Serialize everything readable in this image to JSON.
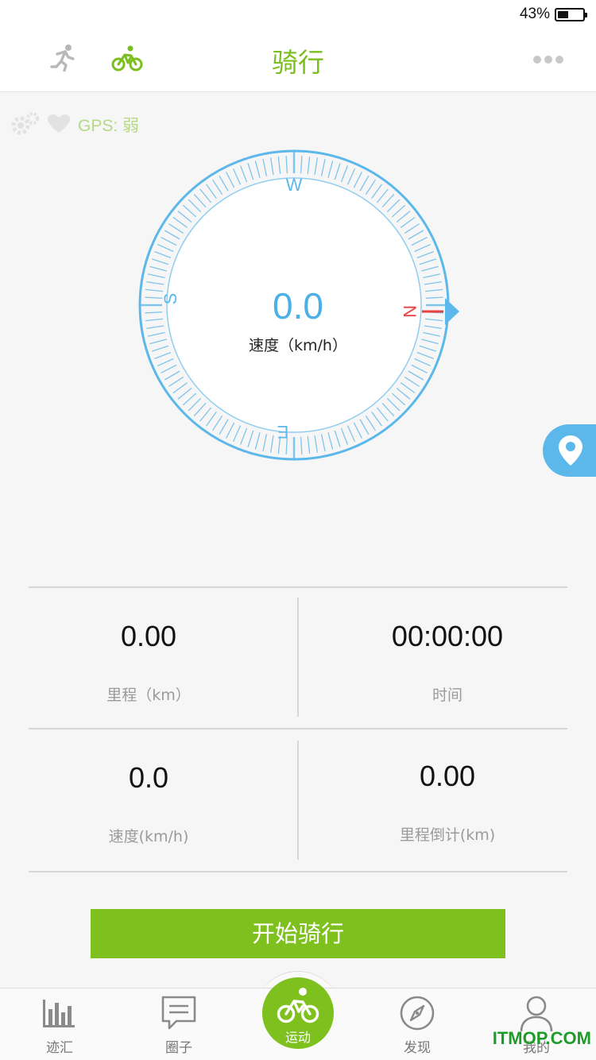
{
  "status_bar": {
    "battery_text": "43%",
    "battery_level": 0.43
  },
  "nav": {
    "title": "骑行",
    "tabs": [
      {
        "icon": "running-icon",
        "active": false
      },
      {
        "icon": "bicycle-icon",
        "active": true
      }
    ],
    "more_icon": "more-icon"
  },
  "gps": {
    "text": "GPS: 弱",
    "icons": [
      "gear-icon",
      "heart-icon"
    ]
  },
  "compass": {
    "directions": {
      "top": "W",
      "right": "N",
      "bottom": "E",
      "left": "S"
    },
    "speed_value": "0.0",
    "speed_label": "速度（km/h）"
  },
  "location_button": {
    "icon": "location-pin-icon"
  },
  "stats": [
    {
      "value": "0.00",
      "label": "里程（km）"
    },
    {
      "value": "00:00:00",
      "label": "时间"
    },
    {
      "value": "0.0",
      "label": "速度(km/h)"
    },
    {
      "value": "0.00",
      "label": "里程倒计(km)"
    }
  ],
  "start_button": {
    "label": "开始骑行"
  },
  "tab_bar": {
    "items": [
      {
        "label": "迹汇",
        "icon": "bar-chart-icon"
      },
      {
        "label": "圈子",
        "icon": "chat-bubble-icon"
      },
      {
        "label": "运动",
        "icon": "bicycle-icon",
        "active": true
      },
      {
        "label": "发现",
        "icon": "compass-icon"
      },
      {
        "label": "我的",
        "icon": "user-icon"
      }
    ]
  },
  "watermark": "ITMOP.COM",
  "colors": {
    "accent_green": "#7ec11f",
    "compass_blue": "#5cb8ea",
    "north_red": "#e84141"
  }
}
